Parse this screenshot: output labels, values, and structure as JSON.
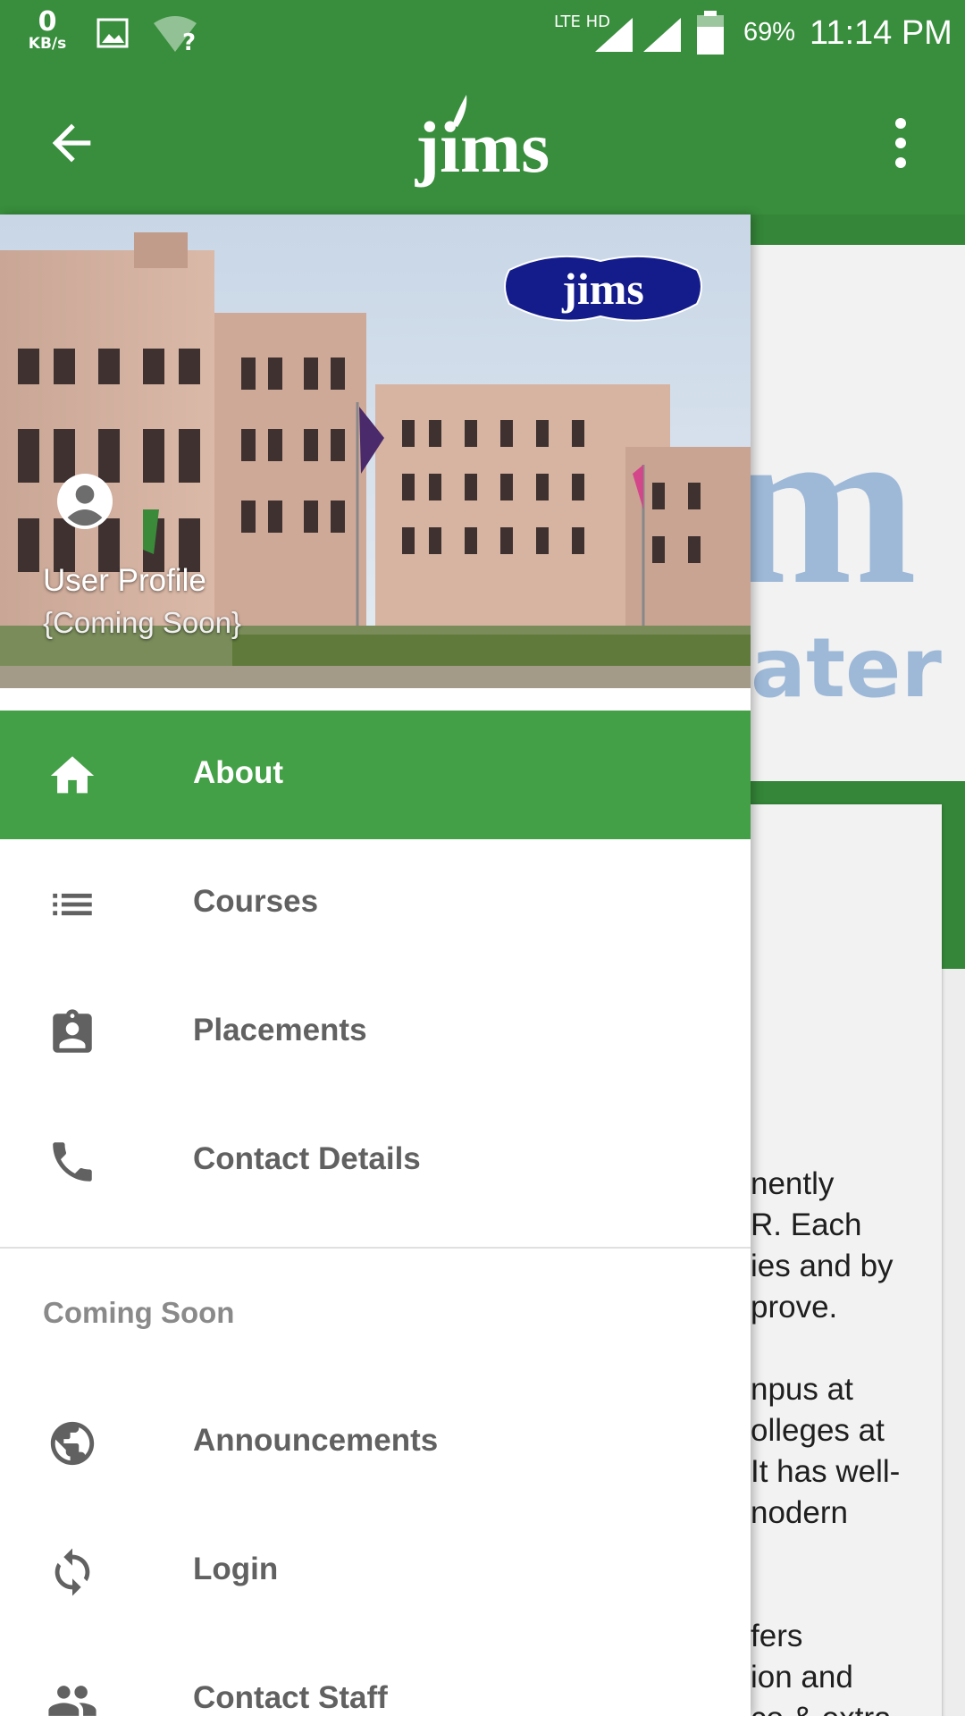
{
  "status_bar": {
    "net_speed": "0",
    "net_unit": "KB/s",
    "network": "LTE HD",
    "battery": "69%",
    "time": "11:14 PM"
  },
  "app_bar": {
    "logo_text": "jims",
    "back_icon": "arrow-back-icon",
    "menu_icon": "more-vert-icon"
  },
  "drawer": {
    "header": {
      "badge_text": "jims",
      "title": "User Profile",
      "subtitle": "{Coming Soon}"
    },
    "items": [
      {
        "label": "About",
        "icon": "home-icon",
        "selected": true
      },
      {
        "label": "Courses",
        "icon": "list-icon",
        "selected": false
      },
      {
        "label": "Placements",
        "icon": "assignment-ind-icon",
        "selected": false
      },
      {
        "label": "Contact Details",
        "icon": "phone-icon",
        "selected": false
      }
    ],
    "section_header": "Coming Soon",
    "coming_soon_items": [
      {
        "label": "Announcements",
        "icon": "globe-icon"
      },
      {
        "label": "Login",
        "icon": "sync-icon"
      },
      {
        "label": "Contact Staff",
        "icon": "people-icon"
      }
    ]
  },
  "background_content": {
    "banner_text_fragments": [
      "m",
      "ater N"
    ],
    "text_lines": [
      "nently",
      "R. Each",
      "ies and by",
      "prove.",
      "npus at",
      "olleges at",
      "It has well-",
      "nodern",
      "fers",
      "ion and",
      " co & extra-"
    ]
  },
  "colors": {
    "primary": "#388e3c",
    "selected": "#43a047",
    "text_secondary": "#616161"
  }
}
